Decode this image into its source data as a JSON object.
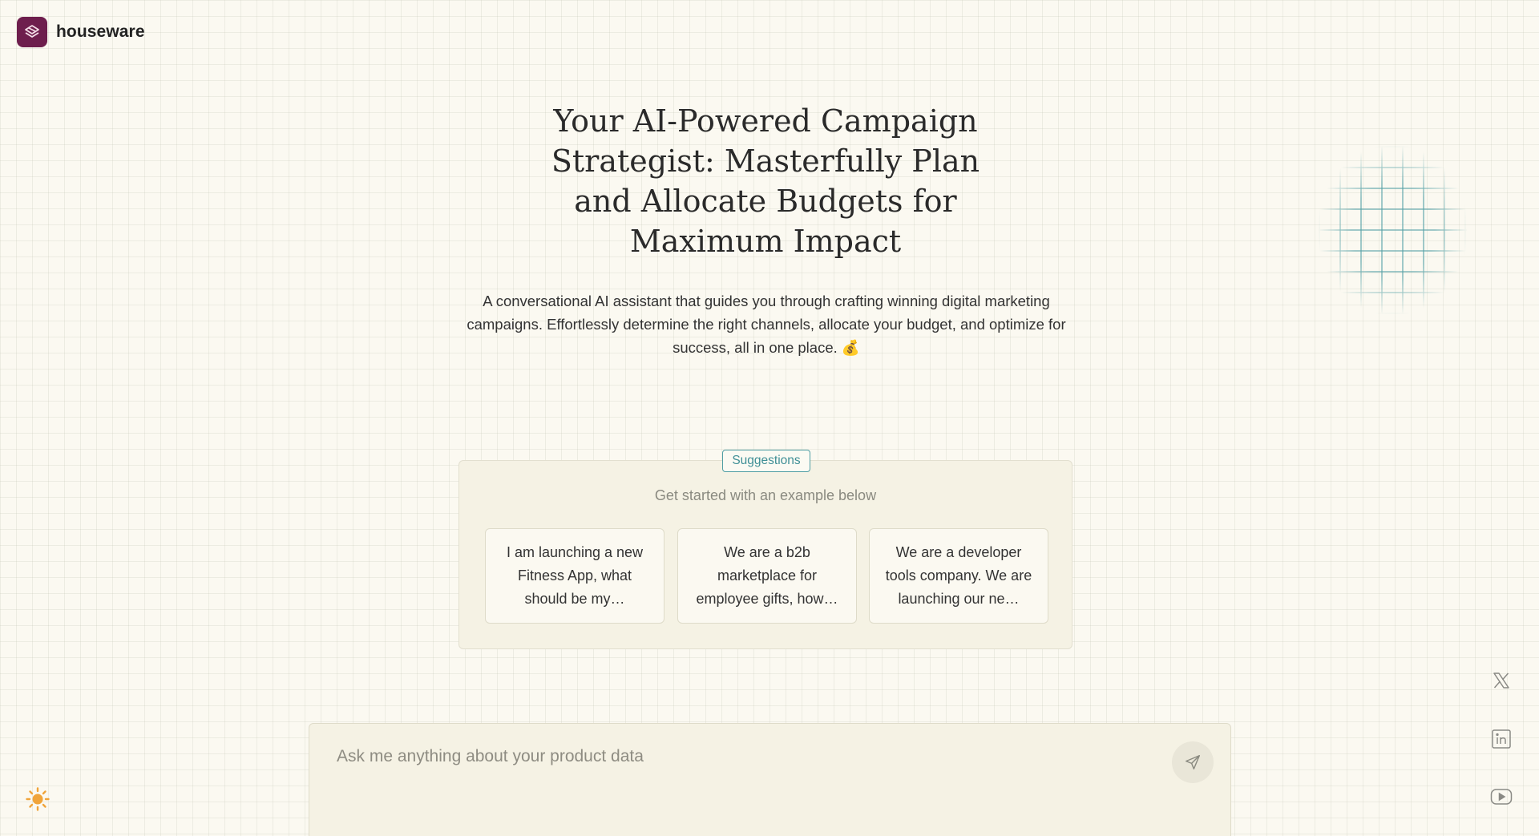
{
  "brand": {
    "name": "houseware",
    "accent_color": "#6e1e4d",
    "logo_icon": "layers-logo-icon"
  },
  "hero": {
    "title": "Your AI-Powered Campaign Strategist: Masterfully Plan and Allocate Budgets for Maximum Impact",
    "subtitle": "A conversational AI assistant that guides you through crafting winning digital marketing campaigns. Effortlessly determine the right channels, allocate your budget, and optimize for success, all in one place. 💰"
  },
  "suggestions": {
    "badge": "Suggestions",
    "prompt": "Get started with an example below",
    "items": [
      {
        "label": "I am launching a new Fitness App, what should be my…"
      },
      {
        "label": "We are a b2b marketplace for employee gifts, how…"
      },
      {
        "label": "We are a developer tools company. We are launching our ne…"
      }
    ],
    "badge_color": "#4f9ea4"
  },
  "chat": {
    "placeholder": "Ask me anything about your product data",
    "value": "",
    "send_icon": "send-icon"
  },
  "theme_toggle": {
    "icon": "sun-icon",
    "color": "#f0a43a"
  },
  "social": [
    {
      "icon": "x-twitter-icon"
    },
    {
      "icon": "linkedin-icon"
    },
    {
      "icon": "youtube-icon"
    }
  ],
  "colors": {
    "background": "#fbf9f1",
    "card": "#f5f2e4",
    "grid_accent": "#54a0a6"
  }
}
